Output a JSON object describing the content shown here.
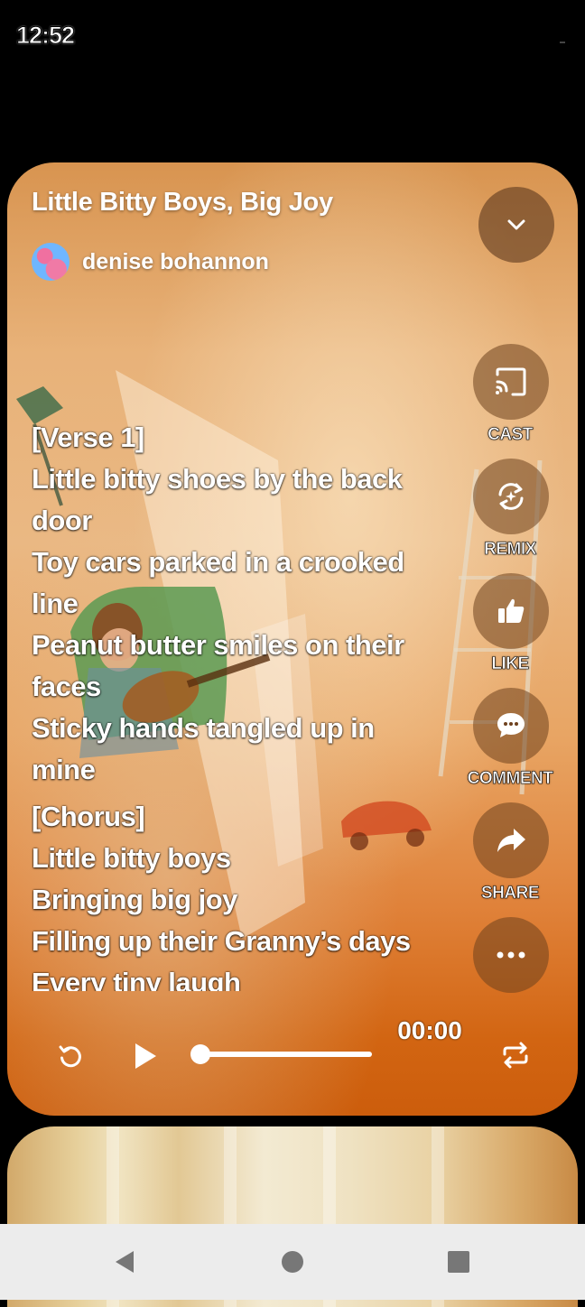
{
  "status_bar": {
    "time": "12:52"
  },
  "song": {
    "title": "Little Bitty Boys, Big Joy",
    "author": "denise bohannon"
  },
  "lyrics": [
    {
      "text": "[Verse 1]",
      "tag": true
    },
    {
      "text": "Little bitty shoes by the back",
      "tag": false
    },
    {
      "text": "door",
      "tag": false
    },
    {
      "text": "Toy cars parked in a crooked",
      "tag": false
    },
    {
      "text": "line",
      "tag": false
    },
    {
      "text": "Peanut butter smiles on their",
      "tag": false
    },
    {
      "text": "faces",
      "tag": false
    },
    {
      "text": "Sticky hands tangled up in",
      "tag": false
    },
    {
      "text": "mine",
      "tag": false
    },
    {
      "text": "[Chorus]",
      "tag": true
    },
    {
      "text": "Little bitty boys",
      "tag": false
    },
    {
      "text": "Bringing big joy",
      "tag": false
    },
    {
      "text": "Filling up their Granny’s days",
      "tag": false
    },
    {
      "text": "Every tiny laugh",
      "tag": false
    }
  ],
  "actions": {
    "cast": "CAST",
    "remix": "REMIX",
    "like": "LIKE",
    "comment": "COMMENT",
    "share": "SHARE"
  },
  "player": {
    "time": "00:00",
    "progress": 0.0
  },
  "icons": {
    "collapse": "chevron-down-icon",
    "cast": "cast-icon",
    "remix": "remix-icon",
    "like": "thumbs-up-icon",
    "comment": "comment-bubble-icon",
    "share": "share-arrow-icon",
    "more": "more-dots-icon",
    "replay": "replay-icon",
    "play": "play-icon",
    "repeat": "repeat-icon",
    "nav_back": "nav-back-icon",
    "nav_home": "nav-home-icon",
    "nav_recents": "nav-recents-icon"
  },
  "colors": {
    "card_top": "#e8b279",
    "card_bottom": "#cc5d0c",
    "button_fill": "#6e411e",
    "nav_bar": "#ececec"
  }
}
